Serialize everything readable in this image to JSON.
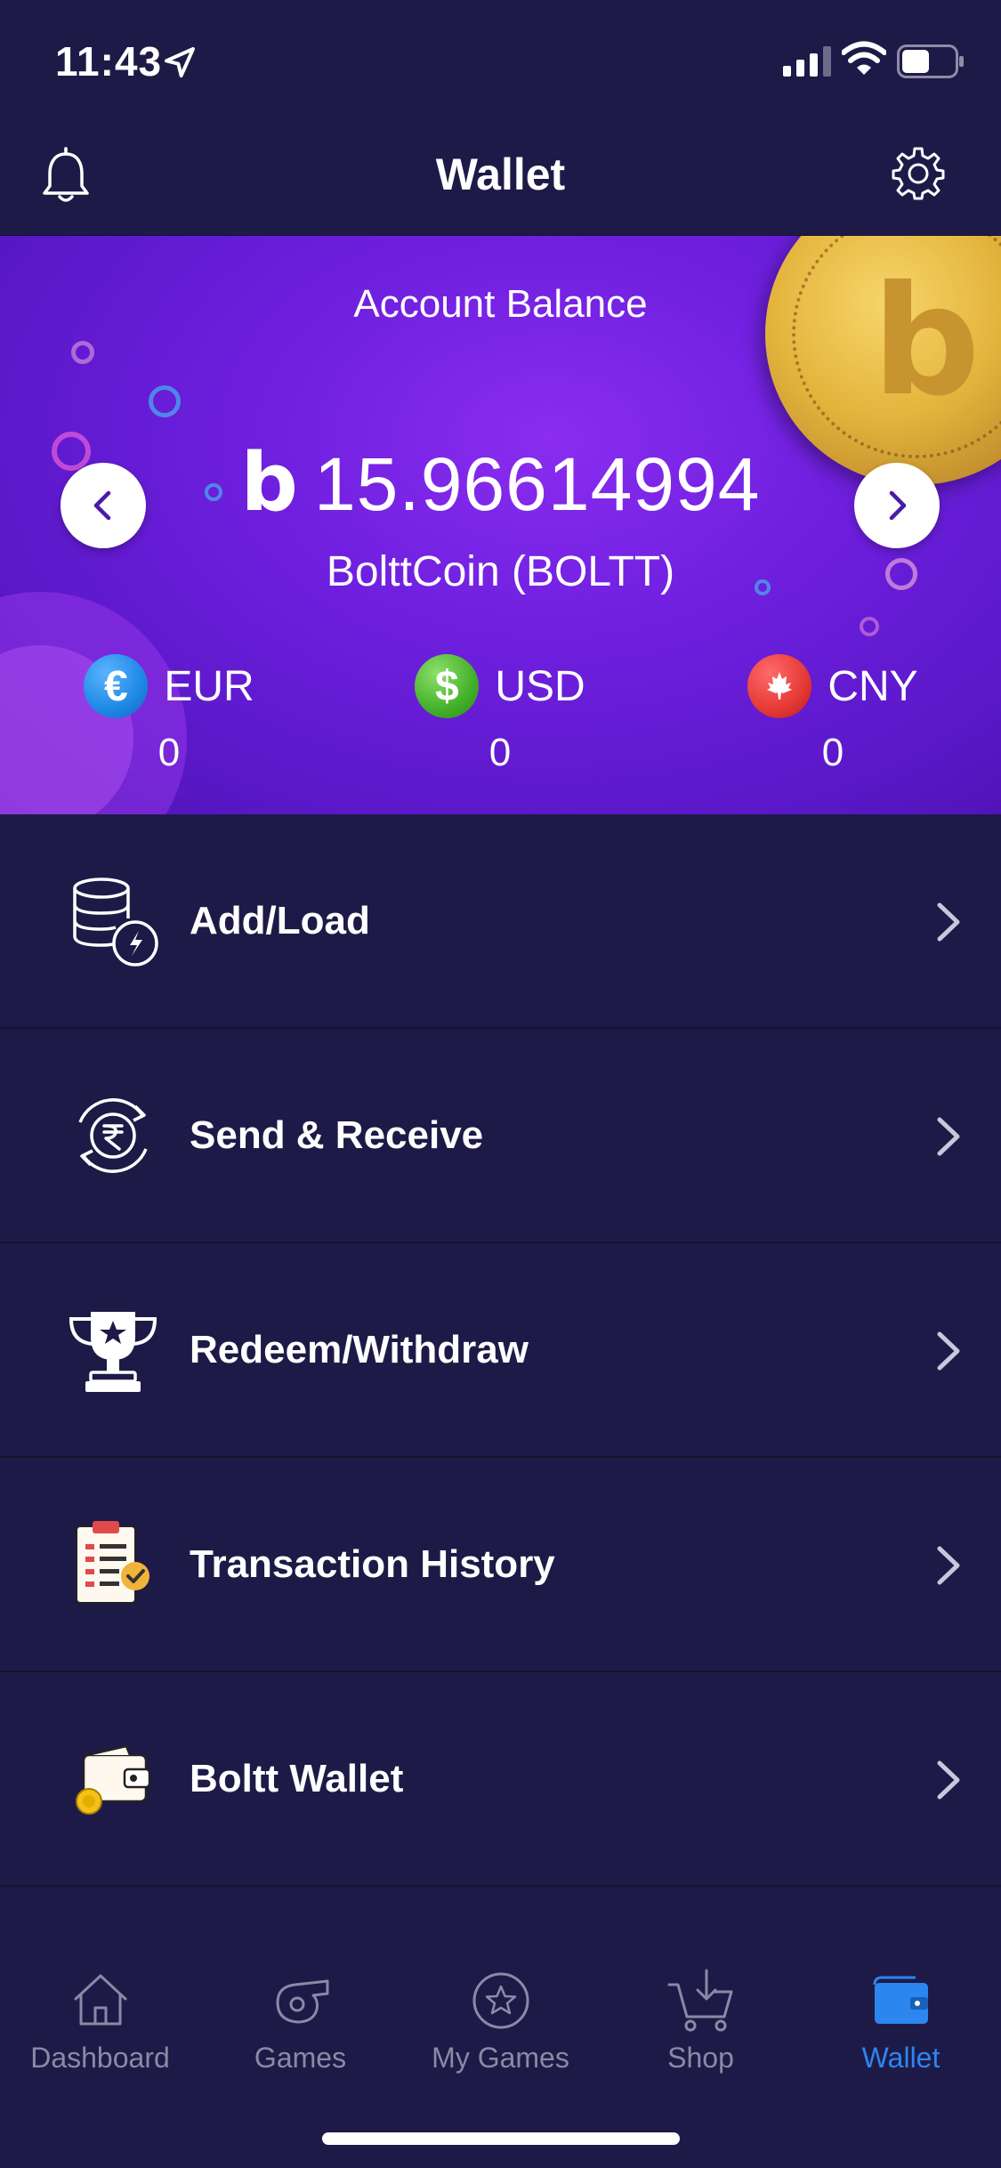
{
  "status_bar": {
    "time": "11:43"
  },
  "header": {
    "title": "Wallet"
  },
  "balance": {
    "label": "Account Balance",
    "symbol": "b",
    "amount": "15.96614994",
    "currency": "BolttCoin (BOLTT)"
  },
  "fiat": [
    {
      "code": "EUR",
      "value": "0",
      "symbol": "€",
      "color": "#1e88e5"
    },
    {
      "code": "USD",
      "value": "0",
      "symbol": "$",
      "color": "#43b02a"
    },
    {
      "code": "CNY",
      "value": "0",
      "symbol": "",
      "color": "#e53935"
    }
  ],
  "menu": [
    {
      "label": "Add/Load",
      "icon": "database-lightning-icon"
    },
    {
      "label": "Send & Receive",
      "icon": "rupee-exchange-icon"
    },
    {
      "label": "Redeem/Withdraw",
      "icon": "trophy-icon"
    },
    {
      "label": "Transaction History",
      "icon": "checklist-icon"
    },
    {
      "label": "Boltt Wallet",
      "icon": "wallet-icon"
    }
  ],
  "tabs": [
    {
      "label": "Dashboard",
      "icon": "home-icon",
      "active": false
    },
    {
      "label": "Games",
      "icon": "whistle-icon",
      "active": false
    },
    {
      "label": "My Games",
      "icon": "star-icon",
      "active": false
    },
    {
      "label": "Shop",
      "icon": "cart-icon",
      "active": false
    },
    {
      "label": "Wallet",
      "icon": "wallet-icon",
      "active": true
    }
  ],
  "colors": {
    "background": "#1e1a47",
    "card_purple": "#7020e0",
    "active_tab": "#2b86f0",
    "inactive_tab": "#8b89a6"
  }
}
